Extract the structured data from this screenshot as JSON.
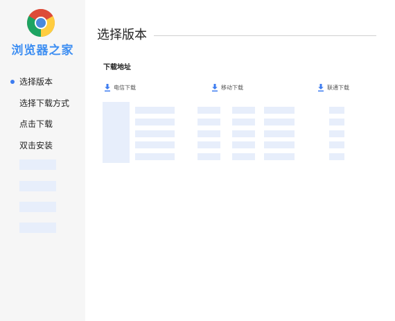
{
  "brand": {
    "name": "浏览器之家"
  },
  "sidebar": {
    "items": [
      {
        "label": "选择版本",
        "active": true
      },
      {
        "label": "选择下载方式",
        "active": false
      },
      {
        "label": "点击下载",
        "active": false
      },
      {
        "label": "双击安装",
        "active": false
      }
    ]
  },
  "main": {
    "title": "选择版本",
    "section_label": "下载地址",
    "links": [
      {
        "label": "电信下载",
        "icon": "download-icon"
      },
      {
        "label": "移动下载",
        "icon": "download-icon"
      },
      {
        "label": "联通下载",
        "icon": "download-icon"
      }
    ]
  },
  "colors": {
    "accent": "#3d7cf0",
    "brand_text": "#3d8ef2",
    "placeholder": "#e7eefb",
    "sidebar_bg": "#f6f6f6"
  }
}
